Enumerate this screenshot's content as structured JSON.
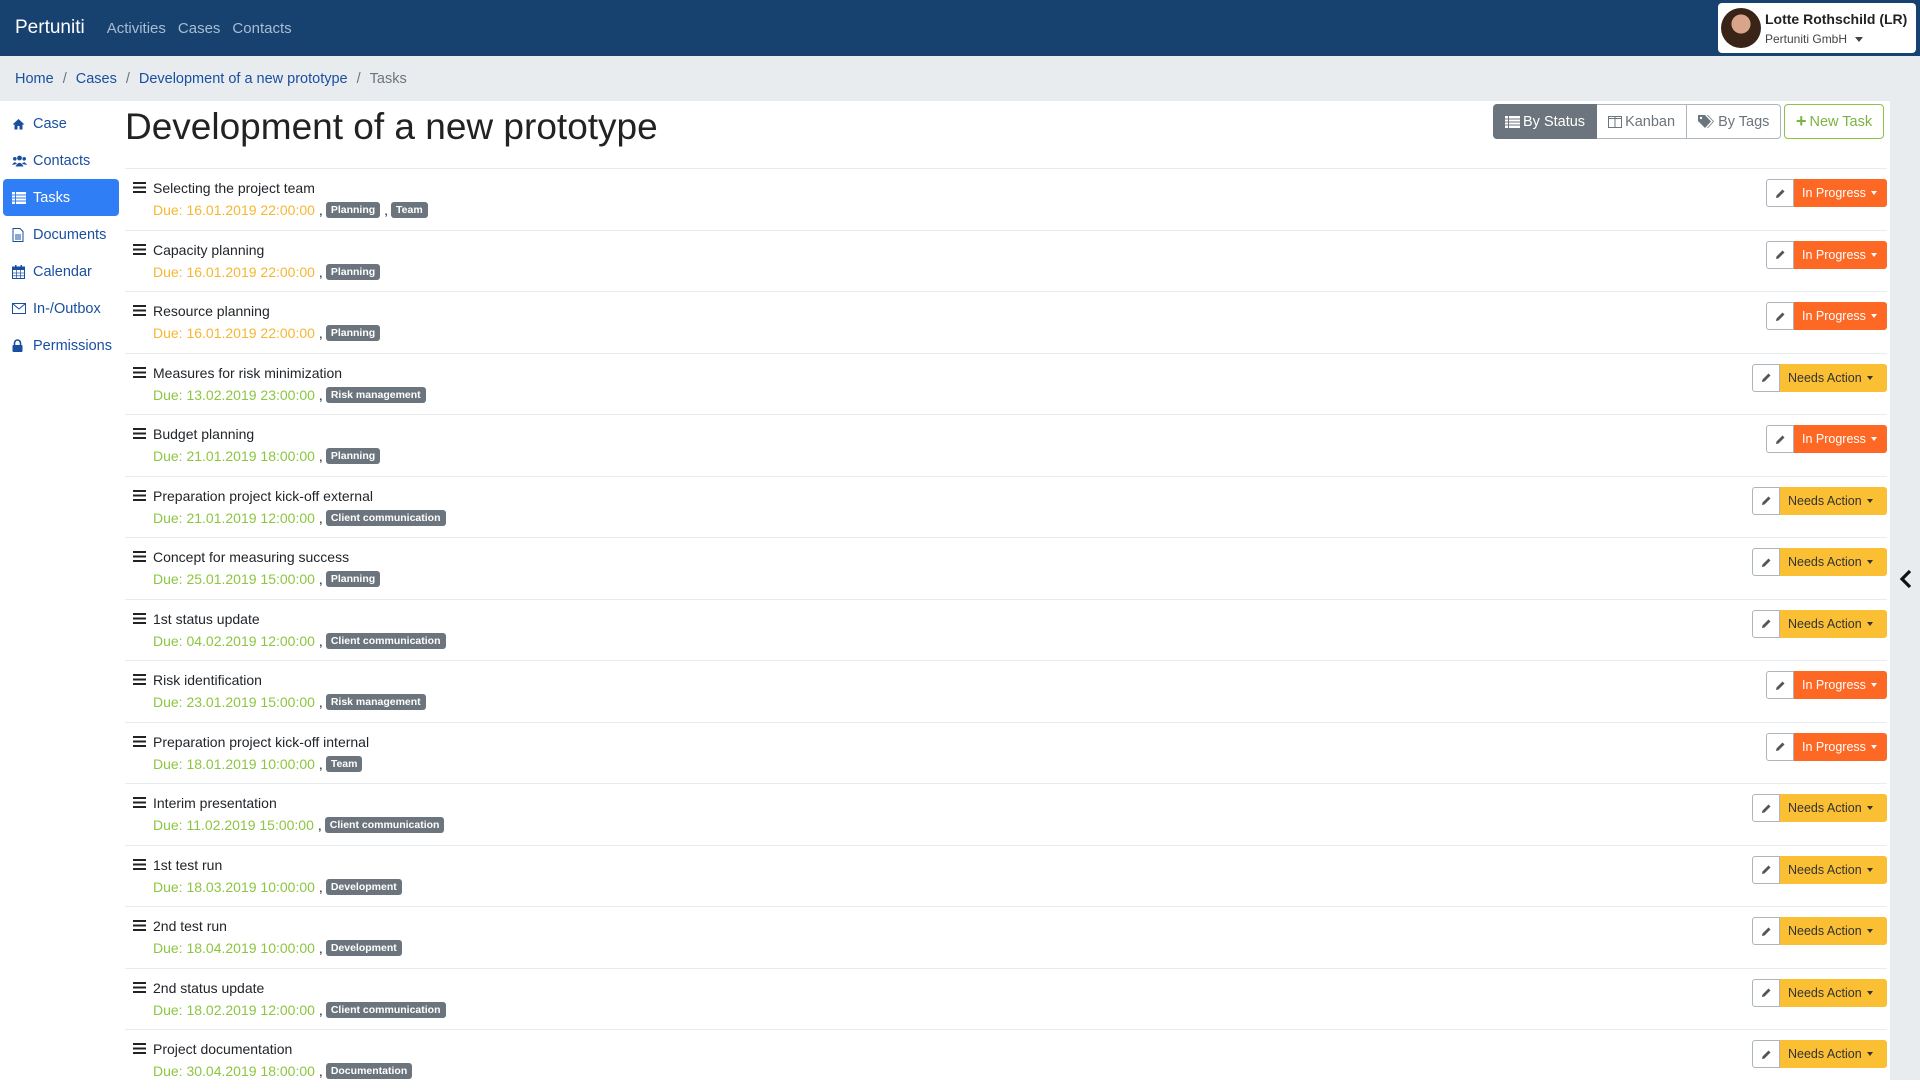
{
  "navbar": {
    "brand": "Pertuniti",
    "links": [
      "Activities",
      "Cases",
      "Contacts"
    ],
    "user": {
      "name": "Lotte Rothschild (LR)",
      "organization": "Pertuniti GmbH"
    }
  },
  "breadcrumb": {
    "items": [
      "Home",
      "Cases",
      "Development of a new prototype"
    ],
    "active": "Tasks"
  },
  "sidebar": {
    "items": [
      {
        "label": "Case",
        "icon": "home-icon"
      },
      {
        "label": "Contacts",
        "icon": "users-icon"
      },
      {
        "label": "Tasks",
        "icon": "list-icon",
        "active": true
      },
      {
        "label": "Documents",
        "icon": "document-icon"
      },
      {
        "label": "Calendar",
        "icon": "calendar-icon"
      },
      {
        "label": "In-/Outbox",
        "icon": "envelope-icon"
      },
      {
        "label": "Permissions",
        "icon": "lock-icon"
      }
    ]
  },
  "main": {
    "title": "Development of a new prototype",
    "views": [
      {
        "label": "By Status",
        "icon": "list-icon",
        "active": true
      },
      {
        "label": "Kanban",
        "icon": "columns-icon"
      },
      {
        "label": "By Tags",
        "icon": "tags-icon"
      }
    ],
    "new_task_label": "New Task"
  },
  "colors": {
    "navbar": "#17426f",
    "in_progress": "#fd6824",
    "needs_action": "#fbbf33",
    "due_soon": "#f5b731",
    "due_ok": "#8cc63f",
    "tag": "#6c757d",
    "active_nav": "#2f7ef5"
  },
  "tasks": [
    {
      "title": "Selecting the project team",
      "due": "Due: 16.01.2019 22:00:00",
      "due_state": "orange",
      "tags": [
        "Planning",
        "Team"
      ],
      "status": "In Progress"
    },
    {
      "title": "Capacity planning",
      "due": "Due: 16.01.2019 22:00:00",
      "due_state": "orange",
      "tags": [
        "Planning"
      ],
      "status": "In Progress"
    },
    {
      "title": "Resource planning",
      "due": "Due: 16.01.2019 22:00:00",
      "due_state": "orange",
      "tags": [
        "Planning"
      ],
      "status": "In Progress"
    },
    {
      "title": "Measures for risk minimization",
      "due": "Due: 13.02.2019 23:00:00",
      "due_state": "green",
      "tags": [
        "Risk management"
      ],
      "status": "Needs Action"
    },
    {
      "title": "Budget planning",
      "due": "Due: 21.01.2019 18:00:00",
      "due_state": "green",
      "tags": [
        "Planning"
      ],
      "status": "In Progress"
    },
    {
      "title": "Preparation project kick-off external",
      "due": "Due: 21.01.2019 12:00:00",
      "due_state": "green",
      "tags": [
        "Client communication"
      ],
      "status": "Needs Action"
    },
    {
      "title": "Concept for measuring success",
      "due": "Due: 25.01.2019 15:00:00",
      "due_state": "green",
      "tags": [
        "Planning"
      ],
      "status": "Needs Action"
    },
    {
      "title": "1st status update",
      "due": "Due: 04.02.2019 12:00:00",
      "due_state": "green",
      "tags": [
        "Client communication"
      ],
      "status": "Needs Action"
    },
    {
      "title": "Risk identification",
      "due": "Due: 23.01.2019 15:00:00",
      "due_state": "green",
      "tags": [
        "Risk management"
      ],
      "status": "In Progress"
    },
    {
      "title": "Preparation project kick-off internal",
      "due": "Due: 18.01.2019 10:00:00",
      "due_state": "green",
      "tags": [
        "Team"
      ],
      "status": "In Progress"
    },
    {
      "title": "Interim presentation",
      "due": "Due: 11.02.2019 15:00:00",
      "due_state": "green",
      "tags": [
        "Client communication"
      ],
      "status": "Needs Action"
    },
    {
      "title": "1st test run",
      "due": "Due: 18.03.2019 10:00:00",
      "due_state": "green",
      "tags": [
        "Development"
      ],
      "status": "Needs Action"
    },
    {
      "title": "2nd test run",
      "due": "Due: 18.04.2019 10:00:00",
      "due_state": "green",
      "tags": [
        "Development"
      ],
      "status": "Needs Action"
    },
    {
      "title": "2nd status update",
      "due": "Due: 18.02.2019 12:00:00",
      "due_state": "green",
      "tags": [
        "Client communication"
      ],
      "status": "Needs Action"
    },
    {
      "title": "Project documentation",
      "due": "Due: 30.04.2019 18:00:00",
      "due_state": "green",
      "tags": [
        "Documentation"
      ],
      "status": "Needs Action"
    }
  ]
}
